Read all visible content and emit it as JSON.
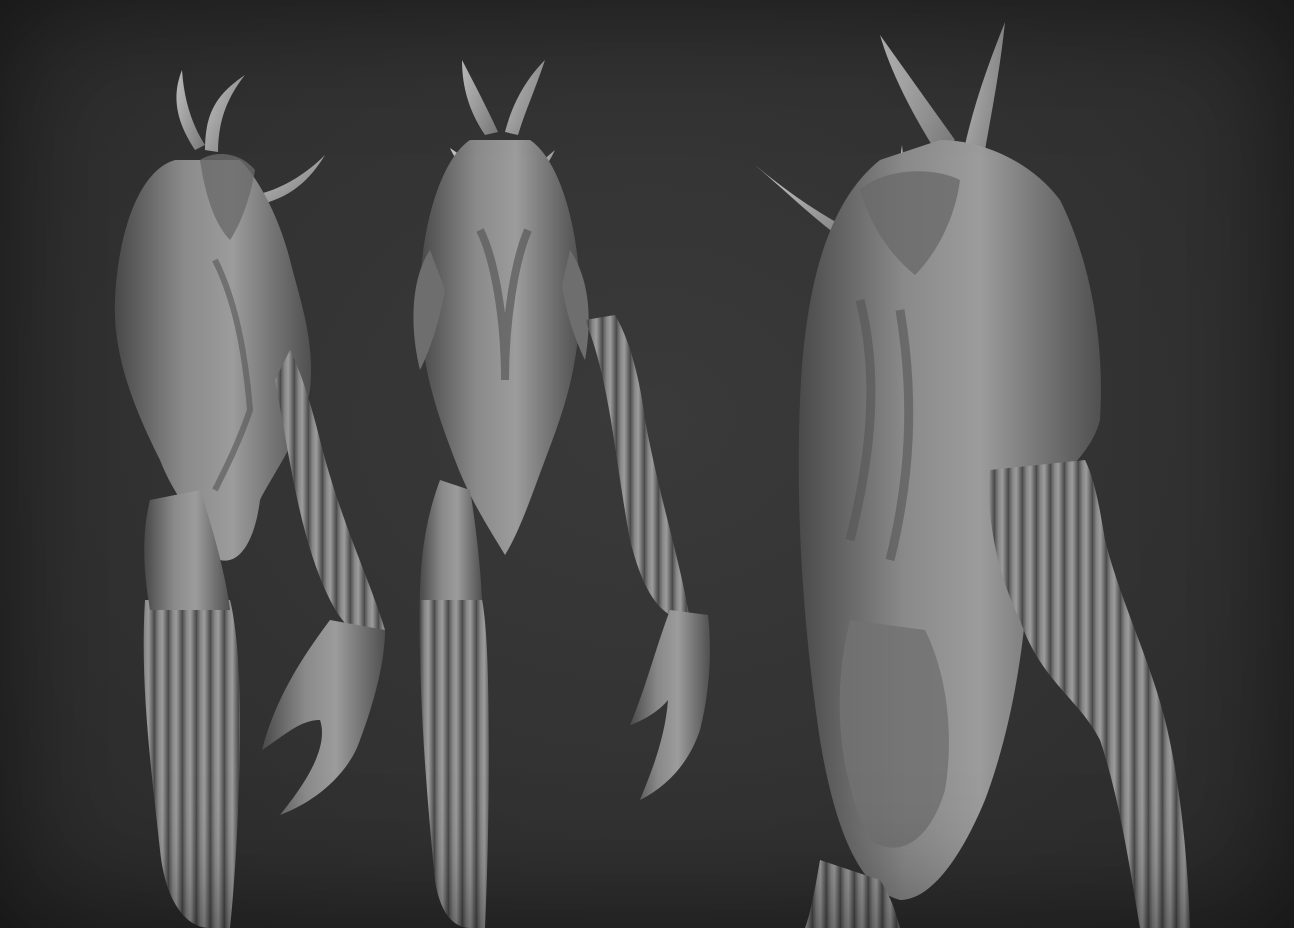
{
  "scene": {
    "subject": "sculpt-render",
    "views": [
      {
        "name": "three-quarter-left"
      },
      {
        "name": "front"
      },
      {
        "name": "close-up"
      }
    ]
  },
  "colors": {
    "background": "#303030",
    "clay_light": "#9a9a9a",
    "clay_mid": "#7c7c7c",
    "clay_dark": "#4e4e4e",
    "horn": "#a8a8a8"
  }
}
